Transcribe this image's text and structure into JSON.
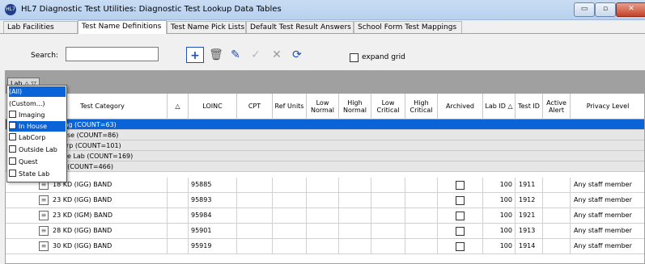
{
  "window": {
    "title": "HL7 Diagnostic Test Utilities:  Diagnostic Test Lookup Data Tables",
    "app_icon_text": "HL7",
    "controls": {
      "minimize": "▭",
      "maximize": "▫",
      "close": "✕"
    }
  },
  "tabs": [
    {
      "label": "Lab Facilities"
    },
    {
      "label": "Test Name Definitions"
    },
    {
      "label": "Test Name Pick Lists"
    },
    {
      "label": "Default Test Result Answers"
    },
    {
      "label": "School Form Test Mappings"
    }
  ],
  "toolbar": {
    "search_label": "Search:",
    "search_value": "",
    "add_icon": "+",
    "delete_icon": "🗑",
    "edit_icon": "✎",
    "ok_icon": "✓",
    "cancel_icon": "✕",
    "refresh_icon": "⟳",
    "expand_grid_label": "expand grid"
  },
  "grid": {
    "group_chip_label": "Lab △ ▽",
    "columns": [
      "Test Category",
      "△",
      "LOINC",
      "CPT",
      "Ref Units",
      "Low Normal",
      "High Normal",
      "Low Critical",
      "High Critical",
      "Archived",
      "Lab ID △",
      "Test ID",
      "Active Alert",
      "Privacy Level"
    ],
    "groups": [
      {
        "label": "Imaging (COUNT=63)"
      },
      {
        "label": "In House (COUNT=86)"
      },
      {
        "label": "LabCorp (COUNT=101)"
      },
      {
        "label": "Outside Lab (COUNT=169)"
      },
      {
        "label": "Quest (COUNT=466)"
      }
    ],
    "rows": [
      {
        "category": "18 KD (IGG) BAND",
        "loinc": "95885",
        "lab_id": "100",
        "test_id": "1911",
        "privacy": "Any staff member"
      },
      {
        "category": "23 KD (IGG) BAND",
        "loinc": "95893",
        "lab_id": "100",
        "test_id": "1912",
        "privacy": "Any staff member"
      },
      {
        "category": "23 KD (IGM) BAND",
        "loinc": "95984",
        "lab_id": "100",
        "test_id": "1921",
        "privacy": "Any staff member"
      },
      {
        "category": "28 KD (IGG) BAND",
        "loinc": "95901",
        "lab_id": "100",
        "test_id": "1913",
        "privacy": "Any staff member"
      },
      {
        "category": "30 KD (IGG) BAND",
        "loinc": "95919",
        "lab_id": "100",
        "test_id": "1914",
        "privacy": "Any staff member"
      }
    ]
  },
  "filter_dropdown": {
    "items": [
      {
        "label": "(All)"
      },
      {
        "label": "(Custom...)"
      },
      {
        "label": "Imaging"
      },
      {
        "label": "In House"
      },
      {
        "label": "LabCorp"
      },
      {
        "label": "Outside Lab"
      },
      {
        "label": "Quest"
      },
      {
        "label": "State Lab"
      }
    ]
  },
  "colors": {
    "selection": "#0b63d8",
    "accent": "#1f4fb0"
  }
}
